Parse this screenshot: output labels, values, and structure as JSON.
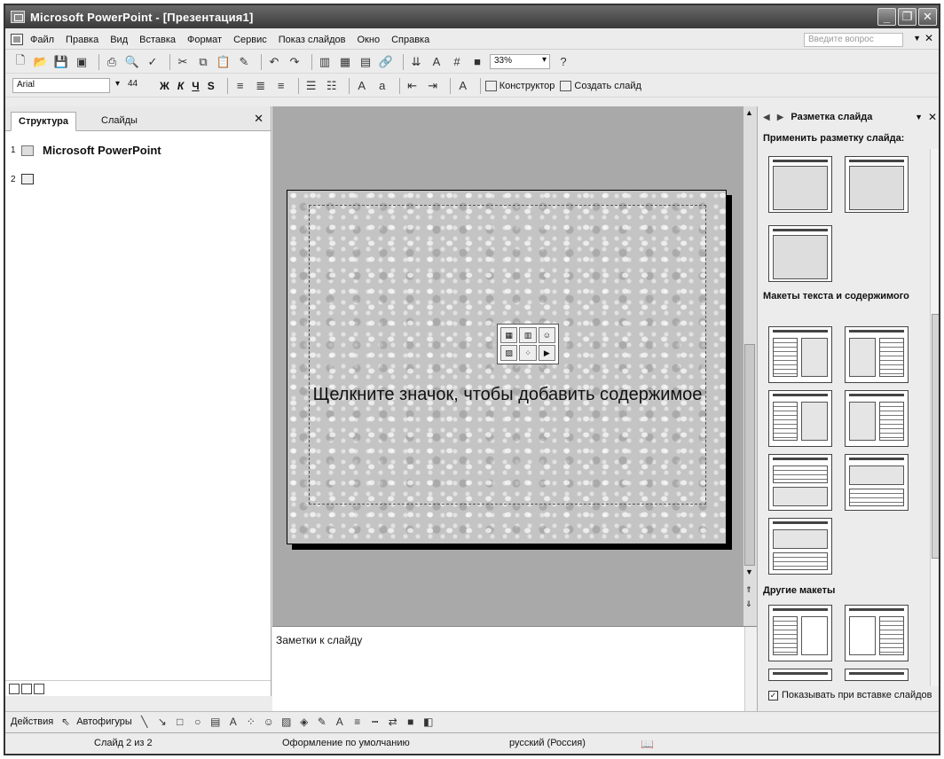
{
  "window": {
    "title": "Microsoft PowerPoint - [Презентация1]"
  },
  "menu": {
    "items": [
      "Файл",
      "Правка",
      "Вид",
      "Вставка",
      "Формат",
      "Сервис",
      "Показ слайдов",
      "Окно",
      "Справка"
    ],
    "help_placeholder": "Введите вопрос"
  },
  "toolbar": {
    "zoom": "33%",
    "font": "Arial",
    "font_size": "44",
    "designer": "Конструктор",
    "new_slide": "Создать слайд"
  },
  "left_panel": {
    "tab_outline": "Структура",
    "tab_slides": "Слайды",
    "slides": [
      {
        "num": "1",
        "title": "Microsoft PowerPoint"
      },
      {
        "num": "2",
        "title": ""
      }
    ]
  },
  "slide": {
    "placeholder_text": "Щелкните значок, чтобы добавить содержимое"
  },
  "notes": {
    "placeholder": "Заметки к слайду"
  },
  "task_pane": {
    "title": "Разметка слайда",
    "apply_label": "Применить разметку слайда:",
    "section_text_content": "Макеты текста и содержимого",
    "section_other": "Другие макеты",
    "show_on_insert": "Показывать при вставке слайдов"
  },
  "drawing": {
    "actions": "Действия",
    "autoshapes": "Автофигуры"
  },
  "status": {
    "slide": "Слайд 2 из 2",
    "design": "Оформление по умолчанию",
    "language": "русский (Россия)"
  }
}
